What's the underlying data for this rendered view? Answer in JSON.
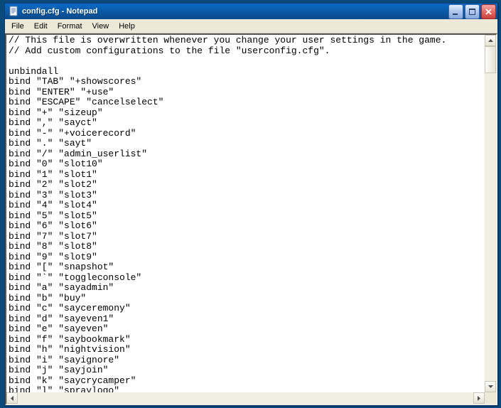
{
  "window": {
    "title": "config.cfg - Notepad"
  },
  "menu": {
    "file": "File",
    "edit": "Edit",
    "format": "Format",
    "view": "View",
    "help": "Help"
  },
  "content": "// This file is overwritten whenever you change your user settings in the game.\n// Add custom configurations to the file \"userconfig.cfg\".\n\nunbindall\nbind \"TAB\" \"+showscores\"\nbind \"ENTER\" \"+use\"\nbind \"ESCAPE\" \"cancelselect\"\nbind \"+\" \"sizeup\"\nbind \",\" \"sayct\"\nbind \"-\" \"+voicerecord\"\nbind \".\" \"sayt\"\nbind \"/\" \"admin_userlist\"\nbind \"0\" \"slot10\"\nbind \"1\" \"slot1\"\nbind \"2\" \"slot2\"\nbind \"3\" \"slot3\"\nbind \"4\" \"slot4\"\nbind \"5\" \"slot5\"\nbind \"6\" \"slot6\"\nbind \"7\" \"slot7\"\nbind \"8\" \"slot8\"\nbind \"9\" \"slot9\"\nbind \"[\" \"snapshot\"\nbind \"`\" \"toggleconsole\"\nbind \"a\" \"sayadmin\"\nbind \"b\" \"buy\"\nbind \"c\" \"sayceremony\"\nbind \"d\" \"sayeven1\"\nbind \"e\" \"sayeven\"\nbind \"f\" \"saybookmark\"\nbind \"h\" \"nightvision\"\nbind \"i\" \"sayignore\"\nbind \"j\" \"sayjoin\"\nbind \"k\" \"saycrycamper\"\nbind \"l\" \"spraylogo\"\nbind \"m\" \"saysorryboot\"\nbind \"n\" \"saylastwarning\""
}
